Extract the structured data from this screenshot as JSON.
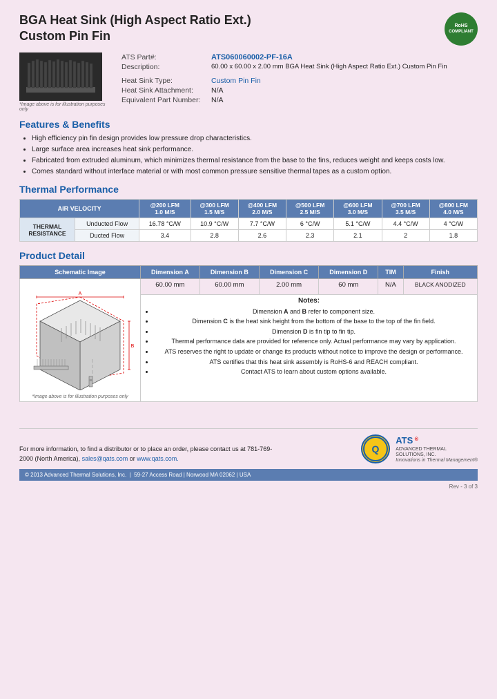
{
  "header": {
    "title_line1": "BGA Heat Sink (High Aspect Ratio Ext.)",
    "title_line2": "Custom Pin Fin",
    "rohs_line1": "RoHS",
    "rohs_line2": "COMPLIANT"
  },
  "part_info": {
    "ats_part_label": "ATS Part#:",
    "ats_part_value": "ATS060060002-PF-16A",
    "description_label": "Description:",
    "description_value": "60.00 x 60.00 x 2.00 mm  BGA Heat Sink (High Aspect Ratio Ext.) Custom Pin Fin",
    "heat_sink_type_label": "Heat Sink Type:",
    "heat_sink_type_value": "Custom Pin Fin",
    "attachment_label": "Heat Sink Attachment:",
    "attachment_value": "N/A",
    "equivalent_label": "Equivalent Part Number:",
    "equivalent_value": "N/A",
    "image_caption": "*Image above is for illustration purposes only"
  },
  "features": {
    "heading": "Features & Benefits",
    "items": [
      "High efficiency pin fin design provides low pressure drop characteristics.",
      "Large surface area increases heat sink performance.",
      "Fabricated from extruded aluminum, which minimizes thermal resistance from the base to the fins, reduces weight and keeps costs low.",
      "Comes standard without interface material or with most common pressure sensitive thermal tapes as a custom option."
    ]
  },
  "thermal_performance": {
    "heading": "Thermal Performance",
    "col_header_left": "AIR VELOCITY",
    "columns": [
      {
        "lfm": "@200 LFM",
        "ms": "1.0 M/S"
      },
      {
        "lfm": "@300 LFM",
        "ms": "1.5 M/S"
      },
      {
        "lfm": "@400 LFM",
        "ms": "2.0 M/S"
      },
      {
        "lfm": "@500 LFM",
        "ms": "2.5 M/S"
      },
      {
        "lfm": "@600 LFM",
        "ms": "3.0 M/S"
      },
      {
        "lfm": "@700 LFM",
        "ms": "3.5 M/S"
      },
      {
        "lfm": "@800 LFM",
        "ms": "4.0 M/S"
      }
    ],
    "row_label": "THERMAL RESISTANCE",
    "unducted_label": "Unducted Flow",
    "ducted_label": "Ducted Flow",
    "unducted_values": [
      "16.78 °C/W",
      "10.9 °C/W",
      "7.7 °C/W",
      "6 °C/W",
      "5.1 °C/W",
      "4.4 °C/W",
      "4 °C/W"
    ],
    "ducted_values": [
      "3.4",
      "2.8",
      "2.6",
      "2.3",
      "2.1",
      "2",
      "1.8"
    ]
  },
  "product_detail": {
    "heading": "Product Detail",
    "schematic_label": "Schematic Image",
    "dim_a_label": "Dimension A",
    "dim_b_label": "Dimension B",
    "dim_c_label": "Dimension C",
    "dim_d_label": "Dimension D",
    "tim_label": "TIM",
    "finish_label": "Finish",
    "dim_a_value": "60.00 mm",
    "dim_b_value": "60.00 mm",
    "dim_c_value": "2.00 mm",
    "dim_d_value": "60 mm",
    "tim_value": "N/A",
    "finish_value": "BLACK ANODIZED",
    "schematic_caption": "*Image above is for illustration purposes only",
    "notes_title": "Notes:",
    "notes": [
      "Dimension A and B refer to component size.",
      "Dimension C is the heat sink height from the bottom of the base to the top of the fin field.",
      "Dimension D is fin tip to fin tip.",
      "Thermal performance data are provided for reference only. Actual performance may vary by application.",
      "ATS reserves the right to update or change its products without notice to improve the design or performance.",
      "ATS certifies that this heat sink assembly is RoHS-6 and REACH compliant.",
      "Contact ATS to learn about custom options available."
    ],
    "notes_bold": [
      "A",
      "B",
      "C",
      "D"
    ]
  },
  "footer": {
    "contact_text": "For more information, to find a distributor or to place an order, please contact us at 781-769-2000 (North America),",
    "email": "sales@qats.com",
    "or_text": "or",
    "website": "www.qats.com.",
    "copyright": "© 2013 Advanced Thermal Solutions, Inc.",
    "address": "59-27 Access Road  |  Norwood MA  02062  |  USA",
    "ats_name": "ATS",
    "ats_full": "ADVANCED\nTHERMAL\nSOLUTIONS, INC.",
    "ats_tagline": "Innovations in Thermal Management®",
    "page_num": "Rev - 3 of 3"
  }
}
